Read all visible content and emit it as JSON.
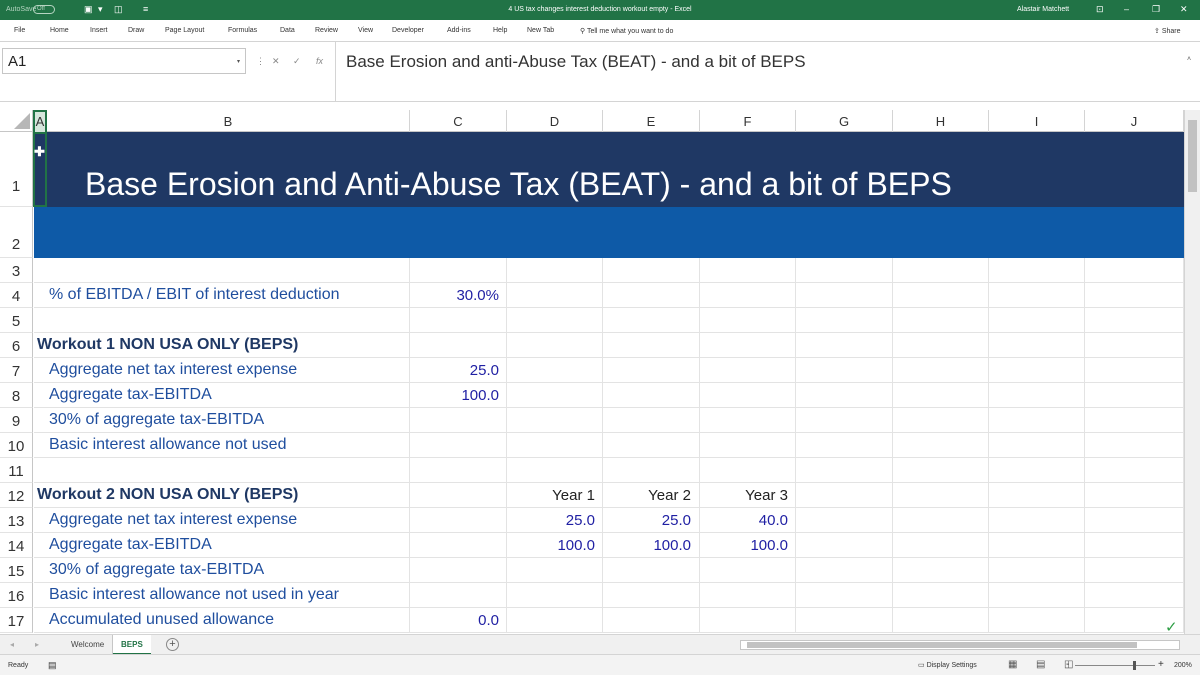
{
  "titlebar": {
    "autosave": "AutoSave",
    "autosave_state": "Off",
    "document_title": "4 US tax changes interest deduction workout empty  -  Excel",
    "user": "Alastair Matchett"
  },
  "ribbon": {
    "tabs": [
      "File",
      "Home",
      "Insert",
      "Draw",
      "Page Layout",
      "Formulas",
      "Data",
      "Review",
      "View",
      "Developer",
      "Add-ins",
      "Help",
      "New Tab"
    ],
    "tell_me": "Tell me what you want to do",
    "share": "Share"
  },
  "formula_bar": {
    "name_box": "A1",
    "content": "Base Erosion and anti-Abuse Tax (BEAT) - and a bit of BEPS"
  },
  "grid": {
    "columns": [
      "A",
      "B",
      "C",
      "D",
      "E",
      "F",
      "G",
      "H",
      "I",
      "J"
    ],
    "title": "Base Erosion and Anti-Abuse Tax (BEAT) - and a bit of BEPS",
    "row_numbers": [
      "1",
      "2",
      "3",
      "4",
      "5",
      "6",
      "7",
      "8",
      "9",
      "10",
      "11",
      "12",
      "13",
      "14",
      "15",
      "16",
      "17"
    ],
    "row4_label": "% of EBITDA / EBIT of interest deduction",
    "row4_value": "30.0%",
    "row6_heading": "Workout 1 NON USA ONLY (BEPS)",
    "row7_label": "Aggregate net tax interest expense",
    "row7_value": "25.0",
    "row8_label": "Aggregate tax-EBITDA",
    "row8_value": "100.0",
    "row9_label": "30% of aggregate tax-EBITDA",
    "row10_label": "Basic interest allowance not used",
    "row12_heading": "Workout 2 NON USA ONLY (BEPS)",
    "row12_years": [
      "Year 1",
      "Year 2",
      "Year 3"
    ],
    "row13_label": "Aggregate net tax interest expense",
    "row13_values": [
      "25.0",
      "25.0",
      "40.0"
    ],
    "row14_label": "Aggregate tax-EBITDA",
    "row14_values": [
      "100.0",
      "100.0",
      "100.0"
    ],
    "row15_label": "30% of aggregate tax-EBITDA",
    "row16_label": "Basic interest allowance not used  in year",
    "row17_label": "Accumulated unused allowance",
    "row17_value": "0.0"
  },
  "sheets": {
    "tabs": [
      "Welcome",
      "BEPS"
    ],
    "active": "BEPS"
  },
  "status": {
    "ready": "Ready",
    "display_settings": "Display Settings",
    "zoom": "200%"
  },
  "colors": {
    "excel_green": "#217346",
    "title_band": "#1f3864",
    "subtitle_band": "#0e5aa7"
  }
}
